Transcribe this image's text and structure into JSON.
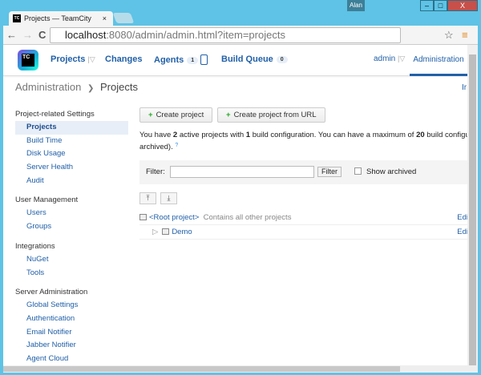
{
  "window": {
    "user": "Alan",
    "minimize": "–",
    "maximize": "□",
    "close": "X"
  },
  "tab": {
    "title": "Projects — TeamCity",
    "icon_text": "TC",
    "close": "×"
  },
  "toolbar": {
    "back": "←",
    "forward": "→",
    "reload": "C",
    "url_host": "localhost",
    "url_rest": ":8080/admin/admin.html?item=projects",
    "star": "☆",
    "menu": "≡"
  },
  "header": {
    "logo": "TC",
    "nav": [
      {
        "label": "Projects",
        "sub": "|▽"
      },
      {
        "label": "Changes"
      },
      {
        "label": "Agents",
        "badge": "1"
      },
      {
        "label": "Build Queue",
        "badge": "0"
      }
    ],
    "user": "admin",
    "user_sub": "|▽",
    "admin": "Administration"
  },
  "breadcrumb": {
    "parent": "Administration",
    "sep": "❯",
    "current": "Projects",
    "right": "Ir"
  },
  "sidebar": [
    {
      "heading": "Project-related Settings",
      "items": [
        "Projects",
        "Build Time",
        "Disk Usage",
        "Server Health",
        "Audit"
      ]
    },
    {
      "heading": "User Management",
      "items": [
        "Users",
        "Groups"
      ]
    },
    {
      "heading": "Integrations",
      "items": [
        "NuGet",
        "Tools"
      ]
    },
    {
      "heading": "Server Administration",
      "items": [
        "Global Settings",
        "Authentication",
        "Email Notifier",
        "Jabber Notifier",
        "Agent Cloud"
      ]
    }
  ],
  "main": {
    "create_project": "Create project",
    "create_from_url": "Create project from URL",
    "info": {
      "a": "You have ",
      "n1": "2",
      "b": " active projects with ",
      "n2": "1",
      "c": " build configuration. You can have a maximum of ",
      "n3": "20",
      "d": " build configurati",
      "line2": "archived).",
      "help": "?"
    },
    "filter": {
      "label": "Filter:",
      "value": "",
      "button": "Filter",
      "show_archived": "Show archived",
      "checked": false
    },
    "collapse": "⤒",
    "expand": "⤓",
    "projects": [
      {
        "name": "<Root project>",
        "desc": "Contains all other projects",
        "edit": "Edi"
      },
      {
        "name": "Demo",
        "toggle": "▷",
        "edit": "Edi"
      }
    ]
  }
}
